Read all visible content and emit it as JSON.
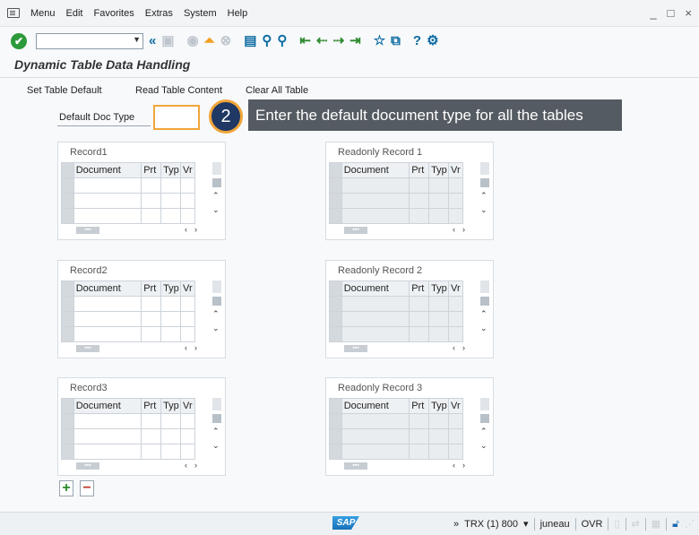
{
  "menubar": {
    "items": [
      "Menu",
      "Edit",
      "Favorites",
      "Extras",
      "System",
      "Help"
    ],
    "window_controls": [
      "_",
      "□",
      "×"
    ]
  },
  "toolbar": {
    "ok_glyph": "✔",
    "command_field_value": "",
    "icons": [
      "back-icon",
      "save-icon",
      "exit-icon",
      "up-icon",
      "cancel-icon",
      "print-icon",
      "find-icon",
      "find-next-icon",
      "first-page-icon",
      "prev-page-icon",
      "next-page-icon",
      "last-page-icon",
      "new-session-icon",
      "shortcut-icon",
      "help-icon",
      "settings-icon"
    ]
  },
  "title": "Dynamic Table Data Handling",
  "app_toolbar": {
    "set_default": "Set Table Default",
    "read_content": "Read Table Content",
    "clear_all": "Clear All Table"
  },
  "default_doc": {
    "label": "Default Doc Type",
    "value": ""
  },
  "callout": {
    "number": "2",
    "text": "Enter the default document type for all the tables"
  },
  "tables": [
    {
      "title": "Record1",
      "readonly": false
    },
    {
      "title": "Readonly Record 1",
      "readonly": true
    },
    {
      "title": "Record2",
      "readonly": false
    },
    {
      "title": "Readonly Record 2",
      "readonly": true
    },
    {
      "title": "Record3",
      "readonly": false
    },
    {
      "title": "Readonly Record 3",
      "readonly": true
    }
  ],
  "columns": [
    "Document",
    "Prt",
    "Typ",
    "Vr"
  ],
  "buttons": {
    "add": "+",
    "remove": "−"
  },
  "statusbar": {
    "logo": "SAP",
    "expand": "»",
    "system": "TRX (1) 800",
    "user": "juneau",
    "mode": "OVR"
  },
  "colors": {
    "accent_orange": "#f0a53a",
    "callout_bg": "#555b62",
    "callout_circle": "#1f3864",
    "toolbar_blue": "#0a6aa1"
  }
}
